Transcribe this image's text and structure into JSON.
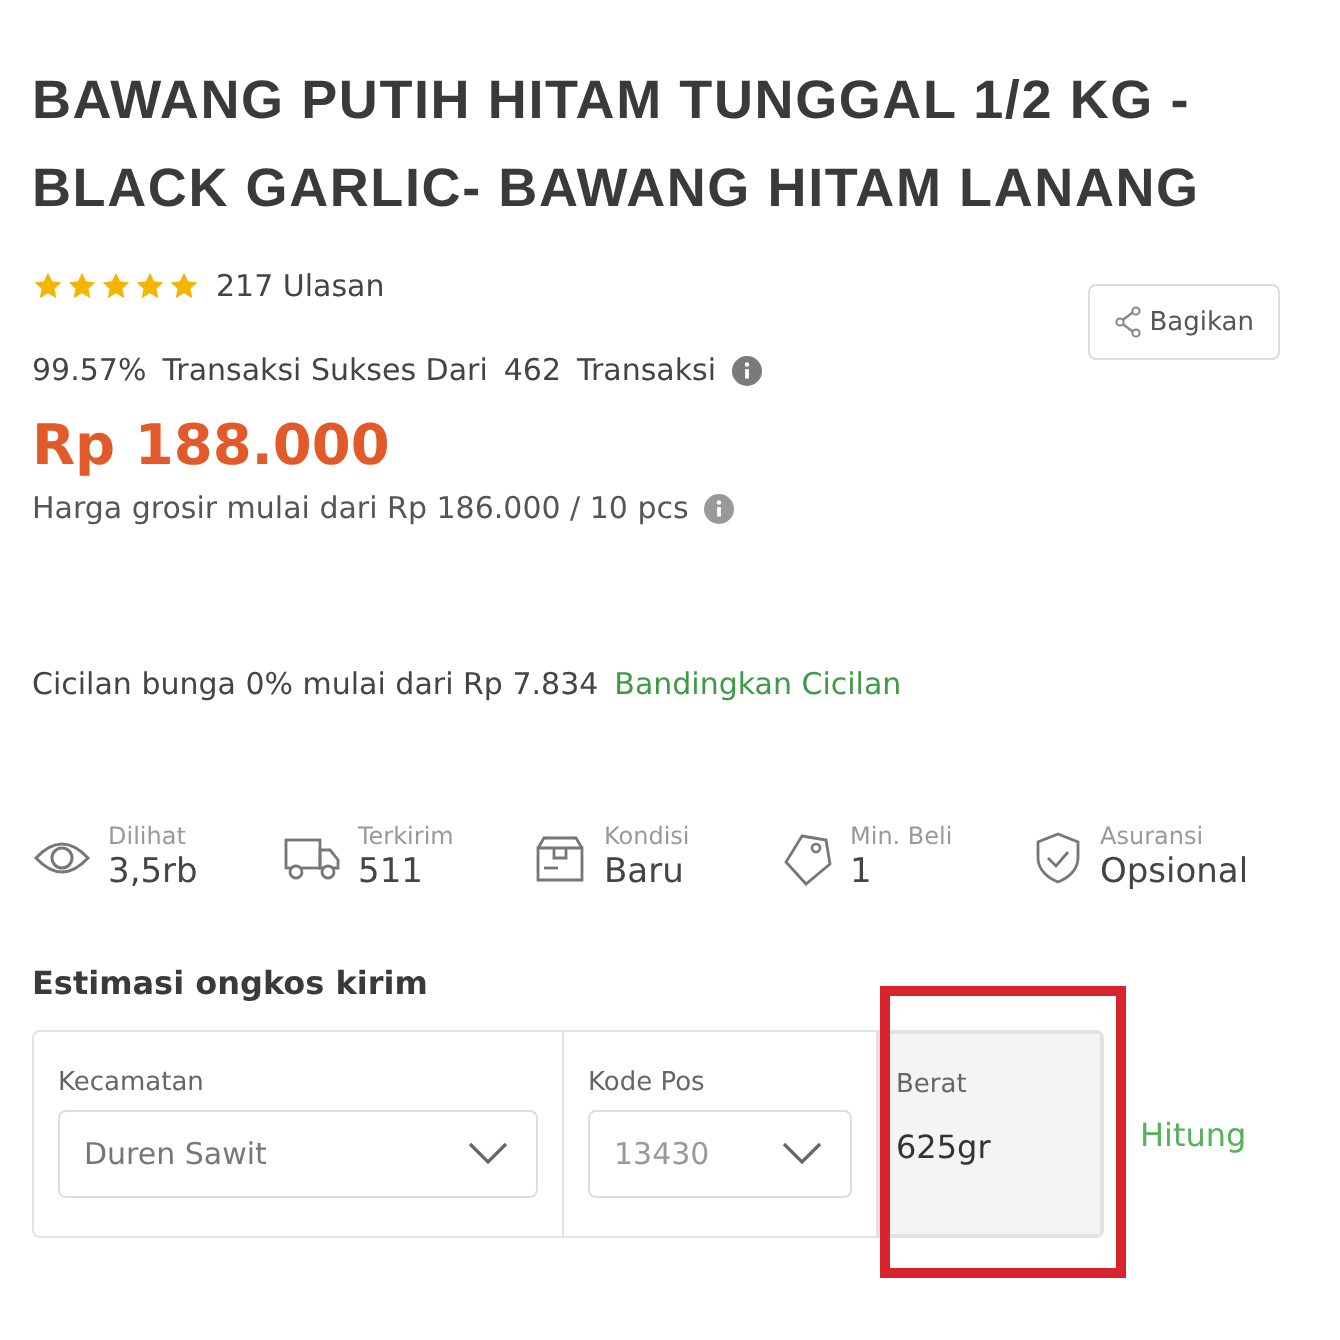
{
  "product": {
    "title": "BAWANG PUTIH HITAM TUNGGAL 1/2 KG - BLACK GARLIC- BAWANG HITAM LANANG",
    "stars": 5,
    "reviews": "217 Ulasan",
    "success_rate": "99.57%",
    "success_text": "Transaksi Sukses Dari",
    "transaction_count": "462",
    "transaction_label": "Transaksi",
    "share_button": "Bagikan",
    "price": "Rp 188.000",
    "wholesale": "Harga grosir mulai dari Rp 186.000 / 10 pcs",
    "installment": "Cicilan bunga 0% mulai dari Rp 7.834",
    "installment_link": "Bandingkan Cicilan"
  },
  "stats": [
    {
      "kind": "views",
      "label": "Dilihat",
      "value": "3,5rb"
    },
    {
      "kind": "shipped",
      "label": "Terkirim",
      "value": "511"
    },
    {
      "kind": "condition",
      "label": "Kondisi",
      "value": "Baru"
    },
    {
      "kind": "min_buy",
      "label": "Min. Beli",
      "value": "1"
    },
    {
      "kind": "insurance",
      "label": "Asuransi",
      "value": "Opsional"
    }
  ],
  "shipping": {
    "title": "Estimasi ongkos kirim",
    "district": {
      "label": "Kecamatan",
      "value": "Duren Sawit"
    },
    "postal_code": {
      "label": "Kode Pos",
      "value": "13430"
    },
    "weight": {
      "label": "Berat",
      "value": "625gr"
    },
    "calculate_link": "Hitung",
    "highlighted": true
  }
}
